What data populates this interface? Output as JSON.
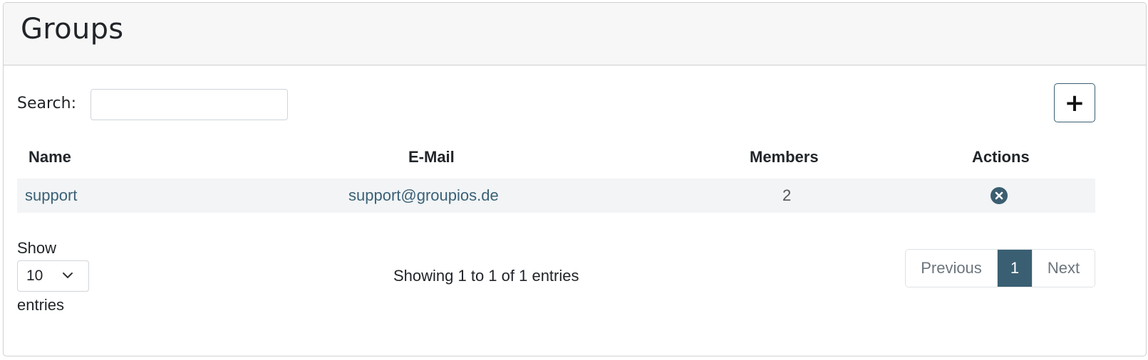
{
  "header": {
    "title": "Groups"
  },
  "search": {
    "label": "Search:",
    "value": "",
    "placeholder": ""
  },
  "add_button": {
    "icon": "plus-icon",
    "label": "+"
  },
  "table": {
    "columns": [
      "Name",
      "E-Mail",
      "Members",
      "Actions"
    ],
    "rows": [
      {
        "name": "support",
        "email": "support@groupios.de",
        "members": "2",
        "action_icon": "delete-circle-icon"
      }
    ]
  },
  "length_menu": {
    "show_label": "Show",
    "selected": "10",
    "entries_label": "entries"
  },
  "info": "Showing 1 to 1 of 1 entries",
  "pagination": {
    "previous": "Previous",
    "current": "1",
    "next": "Next"
  },
  "colors": {
    "accent": "#3a5f72",
    "link": "#3a6176",
    "row_bg": "#f2f4f6",
    "header_bg": "#f7f7f7"
  }
}
